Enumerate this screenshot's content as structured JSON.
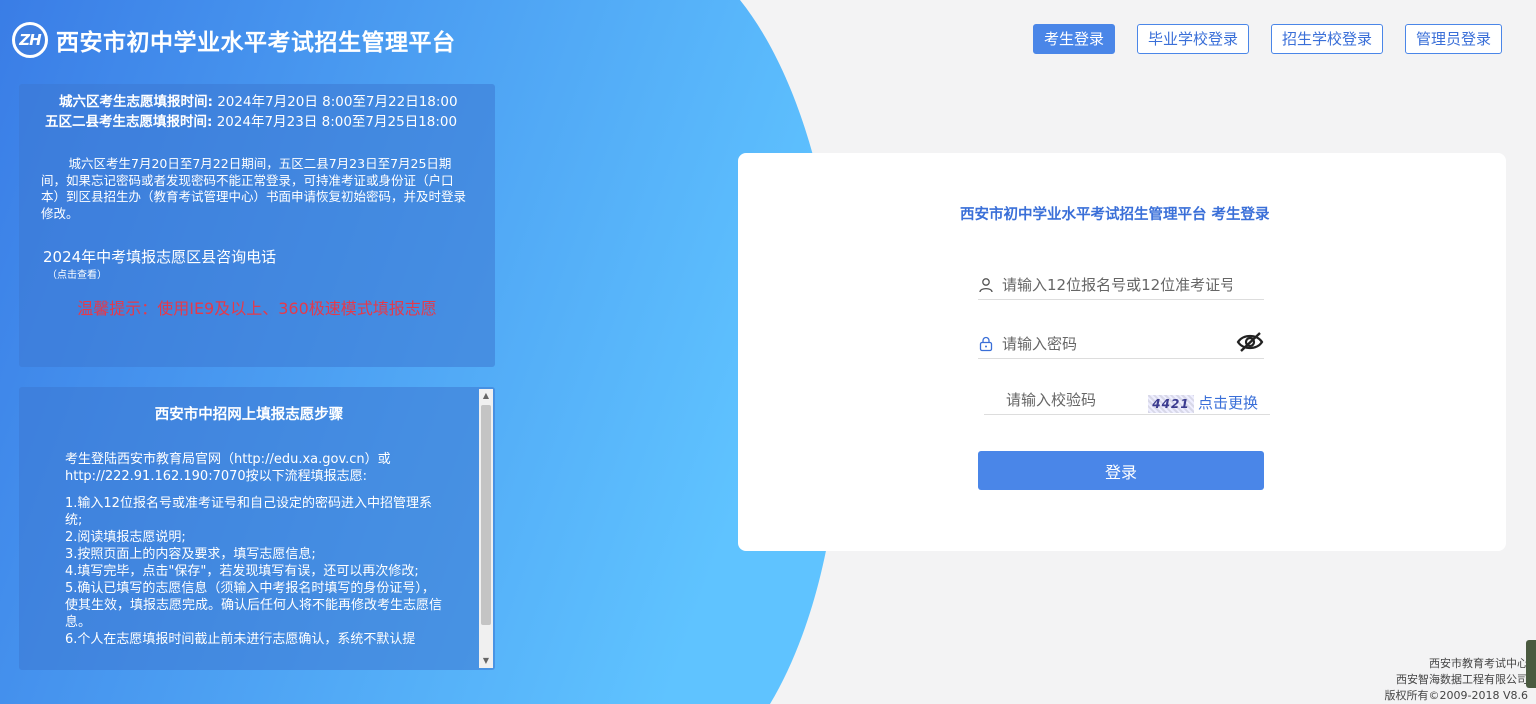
{
  "header": {
    "logo_text": "ZH",
    "title": "西安市初中学业水平考试招生管理平台"
  },
  "nav": {
    "items": [
      {
        "label": "考生登录",
        "active": true
      },
      {
        "label": "毕业学校登录",
        "active": false
      },
      {
        "label": "招生学校登录",
        "active": false
      },
      {
        "label": "管理员登录",
        "active": false
      }
    ]
  },
  "notice": {
    "time1_label": "城六区考生志愿填报时间:",
    "time1_value": "2024年7月20日 8:00至7月22日18:00",
    "time2_label": "五区二县考生志愿填报时间:",
    "time2_value": "2024年7月23日 8:00至7月25日18:00",
    "paragraph": "城六区考生7月20日至7月22日期间，五区二县7月23日至7月25日期间，如果忘记密码或者发现密码不能正常登录，可持准考证或身份证（户口本）到区县招生办（教育考试管理中心）书面申请恢复初始密码，并及时登录修改。",
    "phone_title": "2024年中考填报志愿区县咨询电话",
    "phone_sub": "（点击查看）",
    "warm_tip": "温馨提示：使用IE9及以上、360极速模式填报志愿"
  },
  "steps": {
    "title": "西安市中招网上填报志愿步骤",
    "intro": "考生登陆西安市教育局官网（http://edu.xa.gov.cn）或http://222.91.162.190:7070按以下流程填报志愿:",
    "items": [
      "1.输入12位报名号或准考证号和自己设定的密码进入中招管理系统;",
      "2.阅读填报志愿说明;",
      "3.按照页面上的内容及要求，填写志愿信息;",
      "4.填写完毕，点击\"保存\"，若发现填写有误，还可以再次修改;",
      "5.确认已填写的志愿信息（须输入中考报名时填写的身份证号），使其生效，填报志愿完成。确认后任何人将不能再修改考生志愿信息。",
      "6.个人在志愿填报时间截止前未进行志愿确认，系统不默认提"
    ]
  },
  "login": {
    "title": "西安市初中学业水平考试招生管理平台 考生登录",
    "username_placeholder": "请输入12位报名号或12位准考证号",
    "password_placeholder": "请输入密码",
    "captcha_placeholder": "请输入校验码",
    "captcha_code": "4421",
    "captcha_refresh": "点击更换",
    "submit": "登录"
  },
  "footer": {
    "line1": "西安市教育考试中心",
    "line2": "西安智海数据工程有限公司",
    "line3": "版权所有©2009-2018 V8.6"
  },
  "colors": {
    "accent": "#4a86e8",
    "blue_bg_start": "#3a7de6",
    "blue_bg_end": "#5fc0ff",
    "warn": "#e6394a"
  }
}
